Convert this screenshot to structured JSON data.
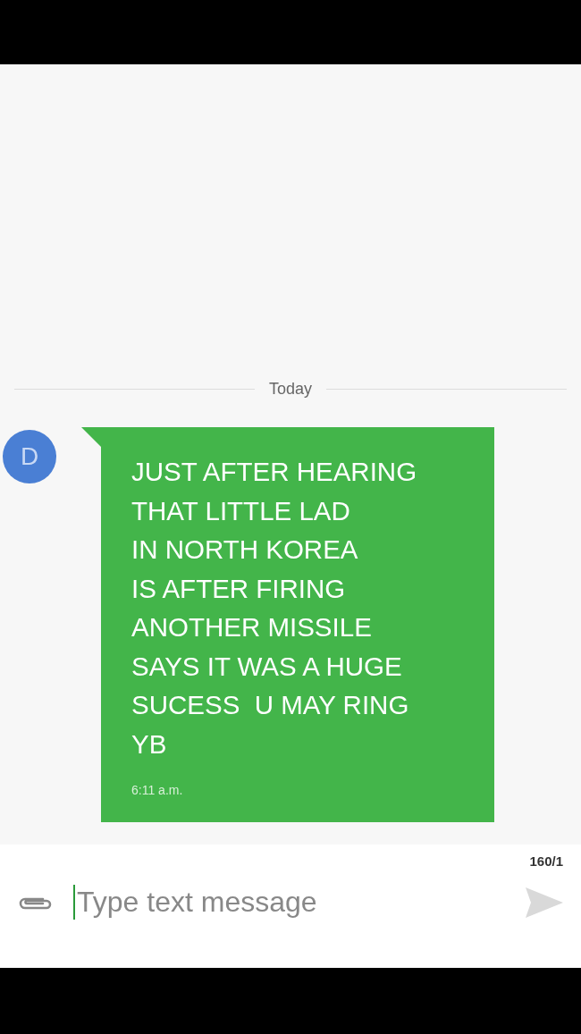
{
  "date_divider": "Today",
  "messages": [
    {
      "avatar_letter": "D",
      "text": "JUST AFTER HEARING\nTHAT LITTLE LAD\nIN NORTH KOREA\nIS AFTER FIRING\nANOTHER MISSILE\nSAYS IT WAS A HUGE\nSUCESS  U MAY RING\nYB",
      "time": "6:11 a.m."
    }
  ],
  "composer": {
    "counter": "160/1",
    "placeholder": "Type text message",
    "send_disabled": true
  }
}
